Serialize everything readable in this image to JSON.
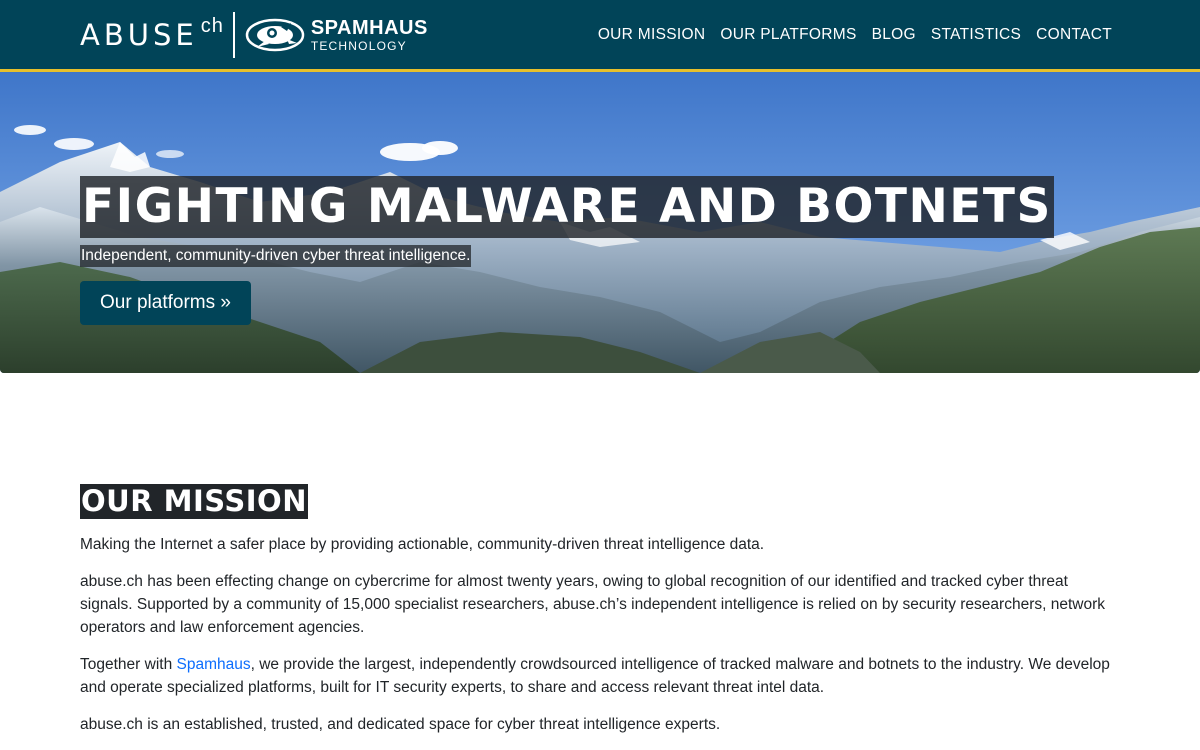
{
  "brand": {
    "abuse": "ABUSE",
    "ch": "ch",
    "partner_line1": "SPAMHAUS",
    "partner_line2": "TECHNOLOGY",
    "partner_icon": "spamhaus-logo-icon"
  },
  "nav": {
    "items": [
      "OUR MISSION",
      "OUR PLATFORMS",
      "BLOG",
      "STATISTICS",
      "CONTACT"
    ]
  },
  "hero": {
    "title": "FIGHTING MALWARE AND BOTNETS",
    "subtitle": "Independent, community-driven cyber threat intelligence.",
    "button_label": "Our platforms »"
  },
  "mission": {
    "heading": "OUR MISSION",
    "p1": "Making the Internet a safer place by providing actionable, community-driven threat intelligence data.",
    "p2": "abuse.ch has been effecting change on cybercrime for almost twenty years, owing to global recognition of our identified and tracked cyber threat signals. Supported by a community of 15,000 specialist researchers, abuse.ch’s independent intelligence is relied on by security researchers, network operators and law enforcement agencies.",
    "p3_before": "Together with ",
    "p3_link": "Spamhaus",
    "p3_after": ", we provide the largest, independently crowdsourced intelligence of tracked malware and botnets to the industry. We develop and operate specialized platforms, built for IT security experts, to share and access relevant threat intel data.",
    "p4": "abuse.ch is an established, trusted, and dedicated space for cyber threat intelligence experts."
  },
  "colors": {
    "navbar": "#014458",
    "navbar_border": "#e7c02c",
    "button": "#014458",
    "link": "#0d6efd",
    "heading_bg": "#212529"
  }
}
